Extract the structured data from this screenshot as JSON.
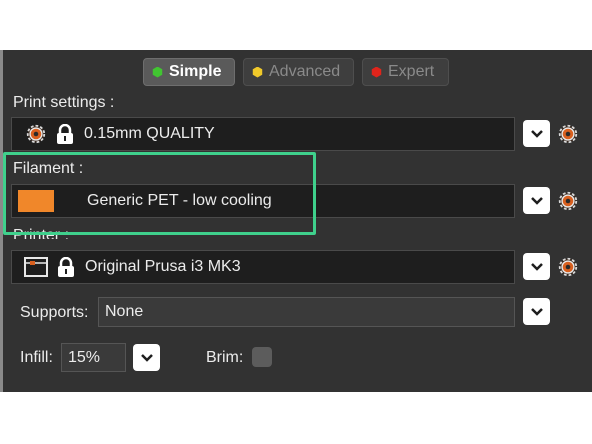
{
  "modes": {
    "simple": {
      "label": "Simple",
      "color": "#41c531"
    },
    "advanced": {
      "label": "Advanced",
      "color": "#f0c92a"
    },
    "expert": {
      "label": "Expert",
      "color": "#e0241b"
    }
  },
  "print_settings": {
    "label": "Print settings :",
    "value": "0.15mm QUALITY",
    "icons": [
      "cog-icon",
      "lock-icon"
    ]
  },
  "filament": {
    "label": "Filament :",
    "value": "Generic PET - low cooling",
    "swatch_color": "#f0872a"
  },
  "printer": {
    "label": "Printer :",
    "value": "Original Prusa i3 MK3",
    "icons": [
      "printer-icon",
      "lock-icon"
    ]
  },
  "supports": {
    "label": "Supports:",
    "value": "None"
  },
  "infill": {
    "label": "Infill:",
    "value": "15%"
  },
  "brim": {
    "label": "Brim:",
    "checked": false
  },
  "colors": {
    "panel_bg": "#323232",
    "highlight": "#3fd08c",
    "icon_accent": "#d9601f"
  }
}
